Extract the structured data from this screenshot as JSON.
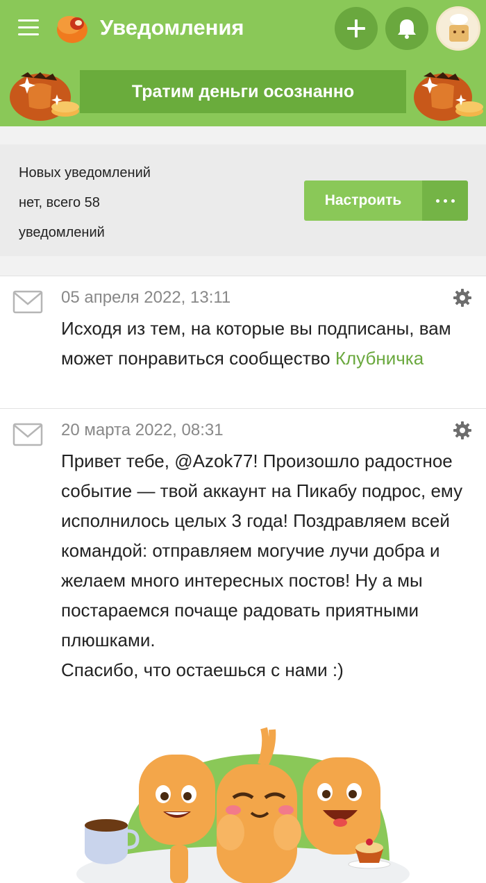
{
  "header": {
    "title": "Уведомления",
    "banner_label": "Тратим деньги осознанно",
    "brand_color": "#8ac858"
  },
  "info": {
    "line1": "Новых уведомлений",
    "line2": "нет, всего 58",
    "line3": "уведомлений",
    "configure_label": "Настроить"
  },
  "notifications": [
    {
      "date": "05 апреля 2022, 13:11",
      "text": "Исходя из тем, на которые вы подписаны, вам может понравиться сообщество ",
      "link": "Клубничка"
    },
    {
      "date": "20 марта 2022, 08:31",
      "text": "Привет тебе, @Azok77! Произошло радостное событие — твой аккаунт на Пикабу подрос, ему исполнилось целых 3 года! Поздравляем всей командой: отправляем могучие лучи добра и желаем много интересных постов! Ну а мы постараемся почаще радовать приятными плюшками.",
      "text2": "Спасибо, что остаешься с нами :)"
    }
  ],
  "icons": [
    "menu-icon",
    "pikabu-logo",
    "plus-icon",
    "bell-icon",
    "avatar",
    "more-icon",
    "envelope-icon",
    "gear-icon"
  ]
}
